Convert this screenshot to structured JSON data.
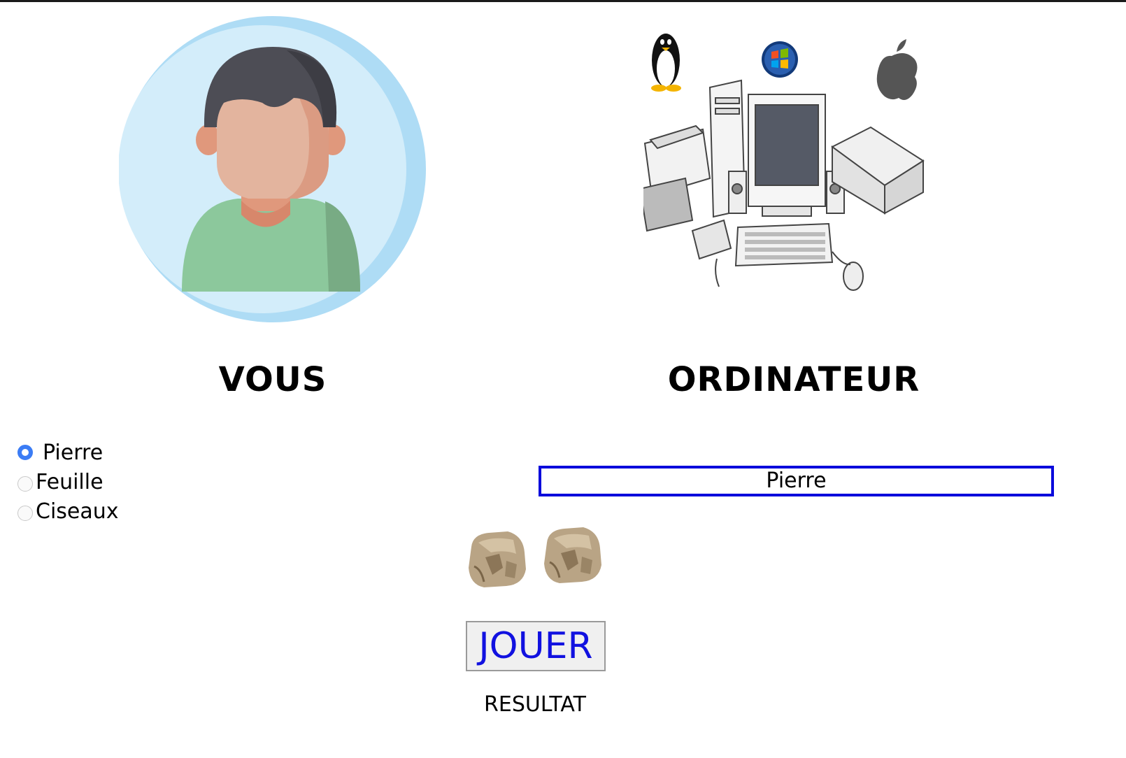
{
  "player": {
    "title": "VOUS",
    "icon": "person-avatar-icon"
  },
  "computer": {
    "title": "ORDINATEUR",
    "icons": [
      "linux-tux-icon",
      "windows-logo-icon",
      "apple-logo-icon",
      "computer-peripherals-icon"
    ]
  },
  "choices": [
    {
      "label": "Pierre",
      "checked": true
    },
    {
      "label": "Feuille",
      "checked": false
    },
    {
      "label": "Ciseaux",
      "checked": false
    }
  ],
  "computer_choice": "Pierre",
  "play_button": "JOUER",
  "result_label": "RESULTAT",
  "colors": {
    "accent_blue": "#0a0adc",
    "radio_blue": "#3b7cf5",
    "button_text": "#1111e0"
  }
}
